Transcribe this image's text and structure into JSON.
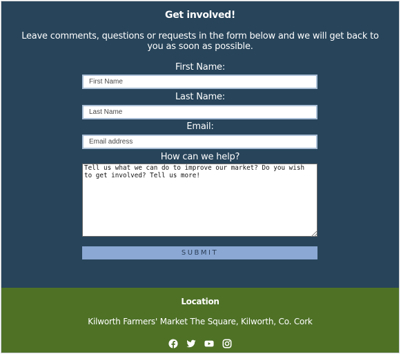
{
  "contact": {
    "title": "Get involved!",
    "intro": "Leave comments, questions or requests in the form below and we will get back to you as soon as possible.",
    "first_name_label": "First Name:",
    "first_name_placeholder": "First Name",
    "last_name_label": "Last Name:",
    "last_name_placeholder": "Last Name",
    "email_label": "Email:",
    "email_placeholder": "Email address",
    "help_label": "How can we help?",
    "help_placeholder": "Tell us what we can do to improve our market? Do you wish to get involved? Tell us more!",
    "submit_label": "SUBMIT"
  },
  "footer": {
    "title": "Location",
    "address": "Kilworth Farmers' Market The Square, Kilworth, Co. Cork",
    "social_icons": [
      "facebook-icon",
      "twitter-icon",
      "youtube-icon",
      "instagram-icon"
    ]
  },
  "colors": {
    "form_background": "#27445a",
    "footer_background": "#4e7126",
    "submit_button": "#8ba8d4"
  }
}
